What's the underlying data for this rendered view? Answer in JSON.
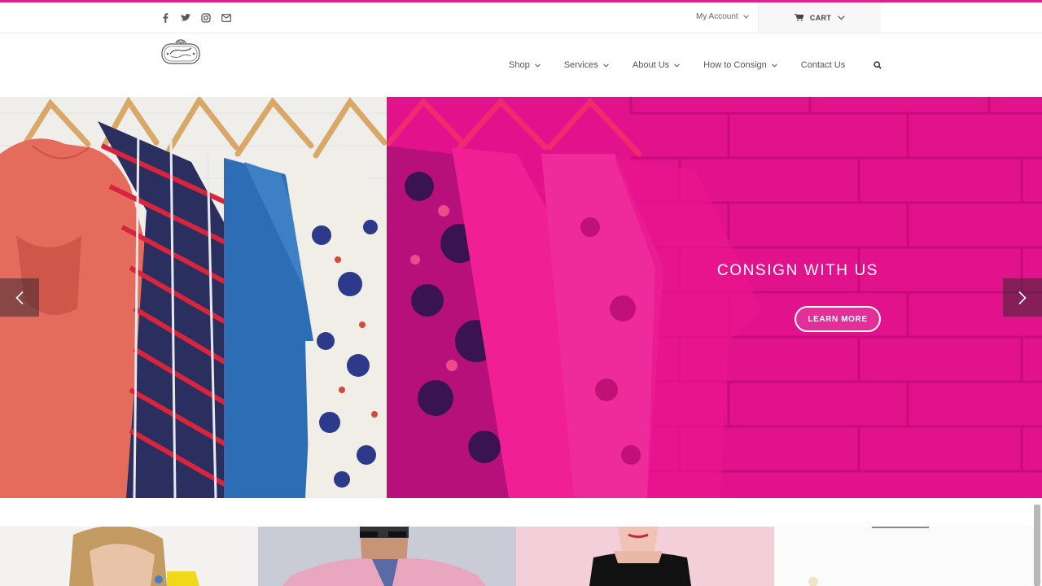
{
  "topbar": {
    "social_icons": [
      "facebook-icon",
      "twitter-icon",
      "instagram-icon",
      "mail-icon"
    ],
    "account_label": "My Account",
    "cart_label": "CART"
  },
  "header": {
    "logo_name": "store-logo",
    "nav": [
      {
        "label": "Shop",
        "has_dropdown": true
      },
      {
        "label": "Services",
        "has_dropdown": true
      },
      {
        "label": "About Us",
        "has_dropdown": true
      },
      {
        "label": "How to Consign",
        "has_dropdown": true
      },
      {
        "label": "Contact Us",
        "has_dropdown": false
      }
    ]
  },
  "hero": {
    "title": "CONSIGN WITH US",
    "button_label": "LEARN MORE"
  },
  "colors": {
    "accent": "#e0218a",
    "hero_overlay": "#e1128c"
  },
  "tiles": [
    "woman-portrait",
    "man-pink-blazer",
    "woman-black-top",
    "white-product"
  ]
}
